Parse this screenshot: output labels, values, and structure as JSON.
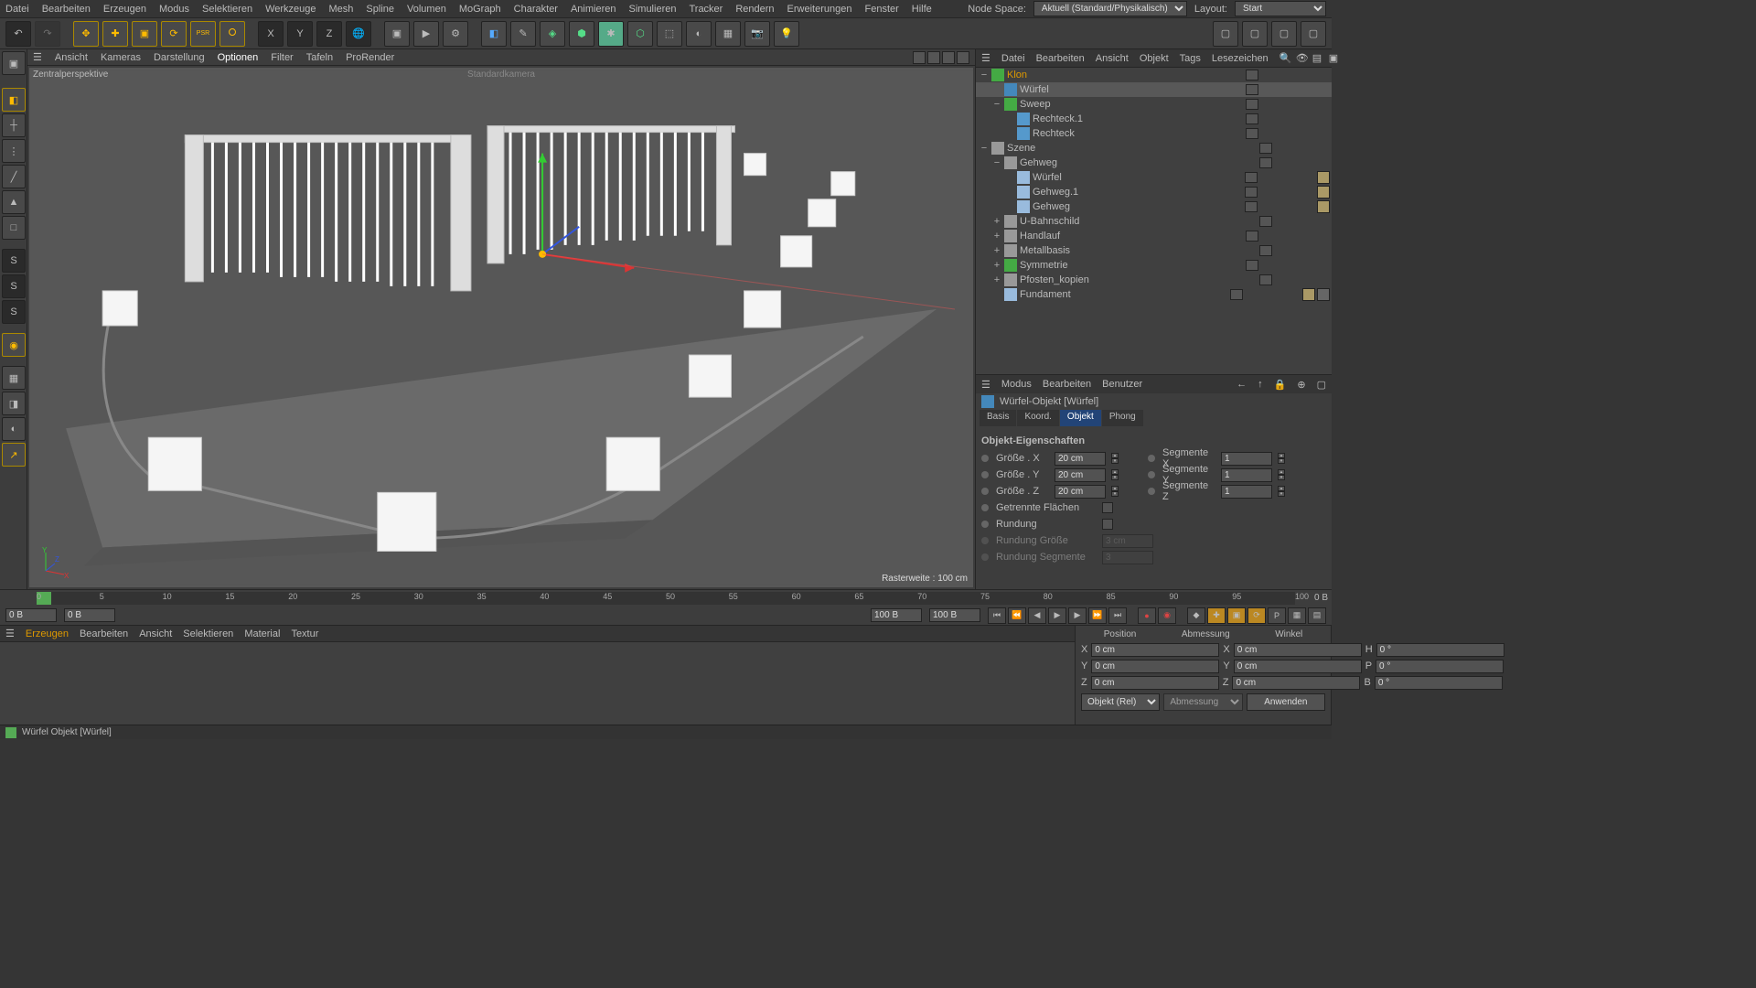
{
  "menubar": {
    "items": [
      "Datei",
      "Bearbeiten",
      "Erzeugen",
      "Modus",
      "Selektieren",
      "Werkzeuge",
      "Mesh",
      "Spline",
      "Volumen",
      "MoGraph",
      "Charakter",
      "Animieren",
      "Simulieren",
      "Tracker",
      "Rendern",
      "Erweiterungen",
      "Fenster",
      "Hilfe"
    ],
    "node_space_label": "Node Space:",
    "node_space_value": "Aktuell (Standard/Physikalisch)",
    "layout_label": "Layout:",
    "layout_value": "Start"
  },
  "viewport_menu": {
    "items": [
      "Ansicht",
      "Kameras",
      "Darstellung",
      "Optionen",
      "Filter",
      "Tafeln",
      "ProRender"
    ],
    "active_index": 3
  },
  "viewport": {
    "title": "Zentralperspektive",
    "camera": "Standardkamera",
    "raster": "Rasterweite : 100 cm"
  },
  "object_panel": {
    "menu": [
      "Datei",
      "Bearbeiten",
      "Ansicht",
      "Objekt",
      "Tags",
      "Lesezeichen"
    ],
    "tree": [
      {
        "indent": 0,
        "expand": "−",
        "name": "Klon",
        "icon": "array",
        "orange": true,
        "tags": [
          "a",
          "b",
          "c"
        ]
      },
      {
        "indent": 1,
        "expand": "",
        "name": "Würfel",
        "icon": "cube",
        "sel": true,
        "tags": [
          "a",
          "b",
          "c"
        ]
      },
      {
        "indent": 1,
        "expand": "−",
        "name": "Sweep",
        "icon": "sweep",
        "tags": [
          "a",
          "b",
          "c"
        ]
      },
      {
        "indent": 2,
        "expand": "",
        "name": "Rechteck.1",
        "icon": "spline",
        "tags": [
          "a",
          "b"
        ]
      },
      {
        "indent": 2,
        "expand": "",
        "name": "Rechteck",
        "icon": "spline",
        "tags": [
          "a",
          "b"
        ]
      },
      {
        "indent": 0,
        "expand": "−",
        "name": "Szene",
        "icon": "null",
        "tags": [
          "a"
        ]
      },
      {
        "indent": 1,
        "expand": "−",
        "name": "Gehweg",
        "icon": "null",
        "tags": [
          "a"
        ]
      },
      {
        "indent": 2,
        "expand": "",
        "name": "Würfel",
        "icon": "poly",
        "tags": [
          "a"
        ],
        "mat": true
      },
      {
        "indent": 2,
        "expand": "",
        "name": "Gehweg.1",
        "icon": "poly",
        "tags": [
          "a"
        ],
        "mat": true
      },
      {
        "indent": 2,
        "expand": "",
        "name": "Gehweg",
        "icon": "poly",
        "tags": [
          "a"
        ],
        "mat": true
      },
      {
        "indent": 1,
        "expand": "+",
        "name": "U-Bahnschild",
        "icon": "null",
        "tags": [
          "a"
        ]
      },
      {
        "indent": 1,
        "expand": "+",
        "name": "Handlauf",
        "icon": "null",
        "tags": [
          "a",
          "b"
        ]
      },
      {
        "indent": 1,
        "expand": "+",
        "name": "Metallbasis",
        "icon": "null",
        "tags": [
          "a"
        ]
      },
      {
        "indent": 1,
        "expand": "+",
        "name": "Symmetrie",
        "icon": "sym",
        "tags": [
          "a",
          "b"
        ]
      },
      {
        "indent": 1,
        "expand": "+",
        "name": "Pfosten_kopien",
        "icon": "null",
        "tags": [
          "a"
        ]
      },
      {
        "indent": 1,
        "expand": "",
        "name": "Fundament",
        "icon": "poly",
        "tags": [
          "a"
        ],
        "mat": true,
        "phong": true
      }
    ]
  },
  "attributes": {
    "menu": [
      "Modus",
      "Bearbeiten",
      "Benutzer"
    ],
    "title": "Würfel-Objekt [Würfel]",
    "tabs": [
      "Basis",
      "Koord.",
      "Objekt",
      "Phong"
    ],
    "active_tab": 2,
    "section": "Objekt-Eigenschaften",
    "size_x_label": "Größe . X",
    "size_x": "20 cm",
    "size_y_label": "Größe . Y",
    "size_y": "20 cm",
    "size_z_label": "Größe . Z",
    "size_z": "20 cm",
    "seg_x_label": "Segmente X",
    "seg_x": "1",
    "seg_y_label": "Segmente Y",
    "seg_y": "1",
    "seg_z_label": "Segmente Z",
    "seg_z": "1",
    "sep_label": "Getrennte Flächen",
    "round_label": "Rundung",
    "round_size_label": "Rundung Größe",
    "round_size": "3 cm",
    "round_seg_label": "Rundung Segmente",
    "round_seg": "3"
  },
  "timeline": {
    "ticks": [
      "0",
      "5",
      "10",
      "15",
      "20",
      "25",
      "30",
      "35",
      "40",
      "45",
      "50",
      "55",
      "60",
      "65",
      "70",
      "75",
      "80",
      "85",
      "90",
      "95",
      "100"
    ],
    "end_label": "0 B"
  },
  "playback": {
    "start": "0 B",
    "current": "0 B",
    "range_end": "100 B",
    "total": "100 B"
  },
  "material_menu": [
    "Erzeugen",
    "Bearbeiten",
    "Ansicht",
    "Selektieren",
    "Material",
    "Textur"
  ],
  "coords": {
    "headers": [
      "Position",
      "Abmessung",
      "Winkel"
    ],
    "rows": [
      {
        "axis": "X",
        "pos": "0 cm",
        "dim_axis": "X",
        "dim": "0 cm",
        "ang_axis": "H",
        "ang": "0 °"
      },
      {
        "axis": "Y",
        "pos": "0 cm",
        "dim_axis": "Y",
        "dim": "0 cm",
        "ang_axis": "P",
        "ang": "0 °"
      },
      {
        "axis": "Z",
        "pos": "0 cm",
        "dim_axis": "Z",
        "dim": "0 cm",
        "ang_axis": "B",
        "ang": "0 °"
      }
    ],
    "mode": "Objekt (Rel)",
    "dim_mode": "Abmessung",
    "apply": "Anwenden"
  },
  "statusbar": "Würfel Objekt [Würfel]"
}
